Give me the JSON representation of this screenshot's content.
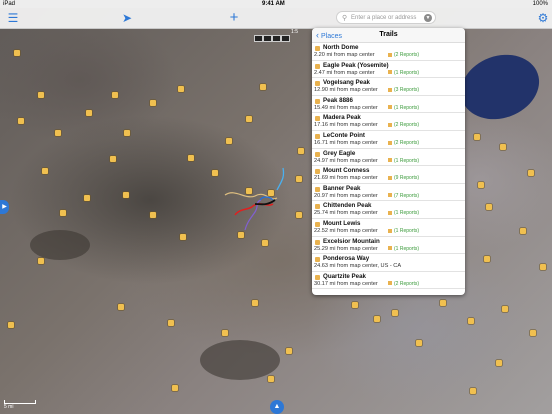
{
  "statusbar": {
    "carrier": "iPad",
    "time": "9:41 AM",
    "battery": "100%"
  },
  "toolbar": {
    "layers_icon": "layers-icon",
    "location_icon": "location-arrow-icon",
    "add_icon": "plus-icon",
    "settings_icon": "gear-icon",
    "search_placeholder": "Enter a place or address"
  },
  "map": {
    "scale_label": "1:5",
    "scale_bar_label": "5 mi"
  },
  "panel": {
    "back_label": "Places",
    "title": "Trails",
    "items": [
      {
        "name": "North Dome",
        "distance": "2.20 mi from map center",
        "reports": "(2 Reports)"
      },
      {
        "name": "Eagle Peak (Yosemite)",
        "distance": "2.47 mi from map center",
        "reports": "(1 Reports)"
      },
      {
        "name": "Vogelsang Peak",
        "distance": "12.90 mi from map center",
        "reports": "(3 Reports)"
      },
      {
        "name": "Peak 8886",
        "distance": "15.49 mi from map center",
        "reports": "(1 Reports)"
      },
      {
        "name": "Madera Peak",
        "distance": "17.16 mi from map center",
        "reports": "(2 Reports)"
      },
      {
        "name": "LeConte Point",
        "distance": "16.71 mi from map center",
        "reports": "(2 Reports)"
      },
      {
        "name": "Grey Eagle",
        "distance": "24.97 mi from map center",
        "reports": "(1 Reports)"
      },
      {
        "name": "Mount Conness",
        "distance": "21.69 mi from map center",
        "reports": "(9 Reports)"
      },
      {
        "name": "Banner Peak",
        "distance": "20.97 mi from map center",
        "reports": "(7 Reports)"
      },
      {
        "name": "Chittenden Peak",
        "distance": "25.74 mi from map center",
        "reports": "(1 Reports)"
      },
      {
        "name": "Mount Lewis",
        "distance": "22.52 mi from map center",
        "reports": "(1 Reports)"
      },
      {
        "name": "Excelsior Mountain",
        "distance": "25.29 mi from map center",
        "reports": "(1 Reports)"
      },
      {
        "name": "Ponderosa Way",
        "distance": "24.63 mi from map center, US - CA",
        "reports": ""
      },
      {
        "name": "Quartzite Peak",
        "distance": "30.17 mi from map center",
        "reports": "(2 Reports)"
      }
    ]
  }
}
